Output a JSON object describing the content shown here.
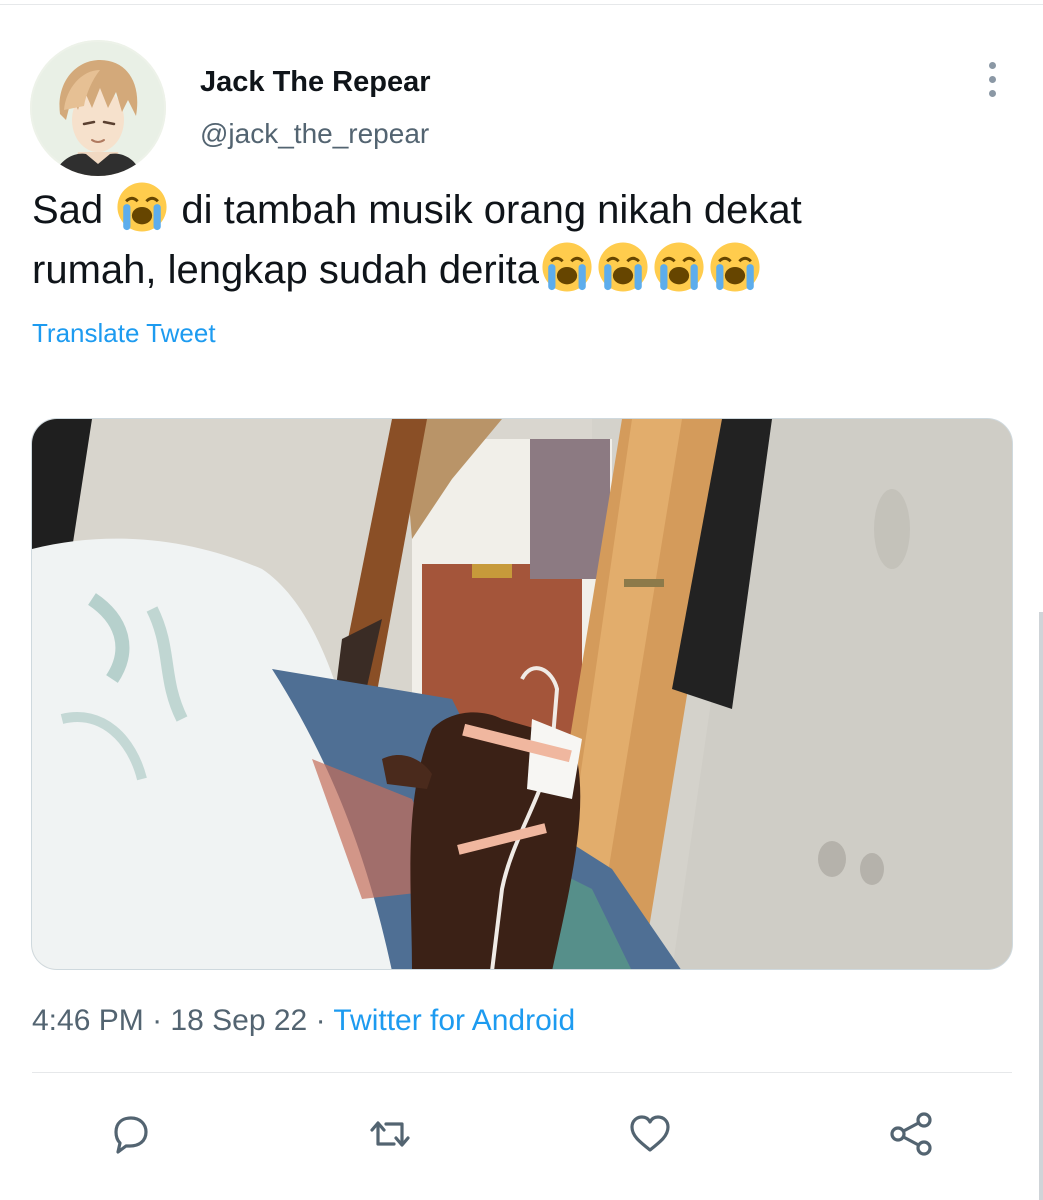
{
  "tweet": {
    "author_name": "Jack The Repear",
    "author_handle": "@jack_the_repear",
    "text_line1_start": "Sad",
    "text_line1_rest": "di tambah musik orang nikah dekat",
    "text_line2": "rumah, lengkap sudah derita",
    "emoji_icon": "loudly-crying-face-icon",
    "translate_label": "Translate Tweet",
    "time": "4:46 PM",
    "separator": "·",
    "date": "18 Sep 22",
    "source": "Twitter for Android"
  },
  "actions": [
    {
      "icon": "reply-icon"
    },
    {
      "icon": "retweet-icon"
    },
    {
      "icon": "like-icon"
    },
    {
      "icon": "share-icon"
    }
  ],
  "colors": {
    "accent": "#1d9bf0",
    "text": "#0f1419",
    "secondary": "#536471",
    "icon": "#536471"
  }
}
